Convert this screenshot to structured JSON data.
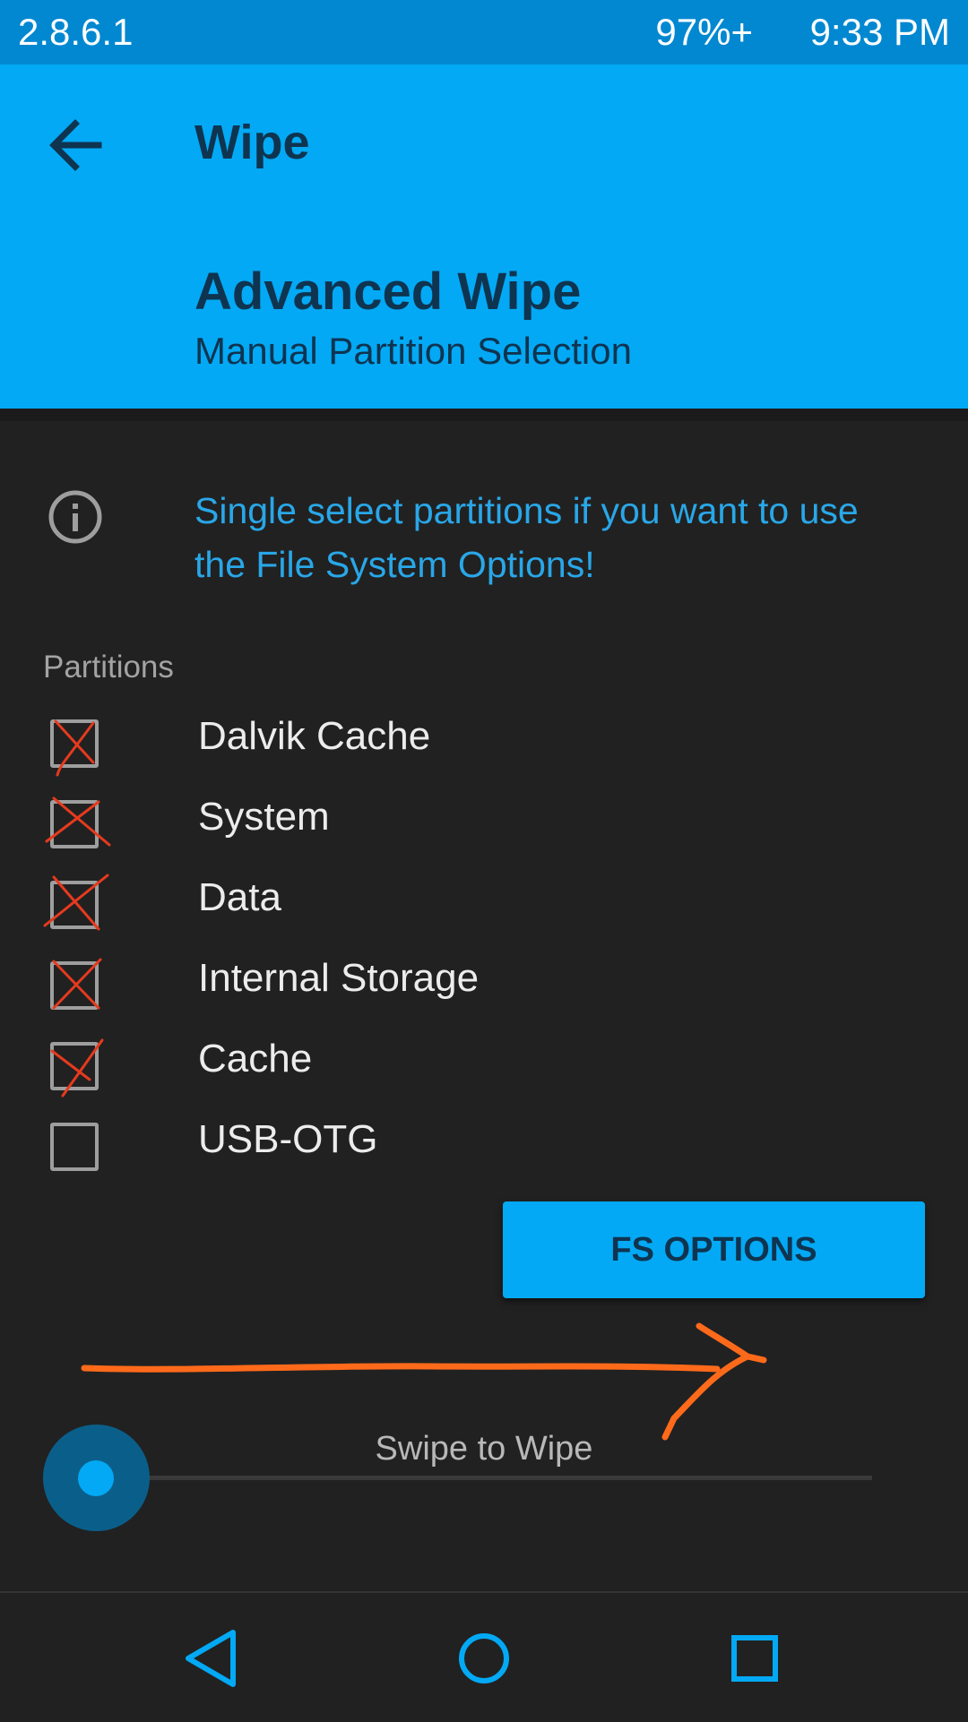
{
  "status_bar": {
    "version": "2.8.6.1",
    "battery": "97%+",
    "time": "9:33 PM"
  },
  "header": {
    "title": "Wipe",
    "section_title": "Advanced Wipe",
    "section_subtitle": "Manual Partition Selection"
  },
  "info": {
    "text": "Single select partitions if you want to use the File System Options!"
  },
  "partitions": {
    "label": "Partitions",
    "items": [
      {
        "label": "Dalvik Cache",
        "checked": true
      },
      {
        "label": "System",
        "checked": true
      },
      {
        "label": "Data",
        "checked": true
      },
      {
        "label": "Internal Storage",
        "checked": true
      },
      {
        "label": "Cache",
        "checked": true
      },
      {
        "label": "USB-OTG",
        "checked": false
      }
    ]
  },
  "fs_options": {
    "label": "FS OPTIONS"
  },
  "swipe": {
    "label": "Swipe to Wipe",
    "progress": 0
  },
  "icons": {
    "back": "arrow-back-icon",
    "info": "info-icon",
    "nav_back": "triangle-back-icon",
    "nav_home": "circle-home-icon",
    "nav_recents": "square-recents-icon"
  },
  "colors": {
    "accent": "#03a9f4",
    "status_bar": "#0288d1",
    "background": "#212121",
    "header_text": "#0f3450",
    "info_text": "#29a7e8",
    "annotation_mark": "#e63a1e",
    "annotation_arrow": "#ff6a1a"
  }
}
